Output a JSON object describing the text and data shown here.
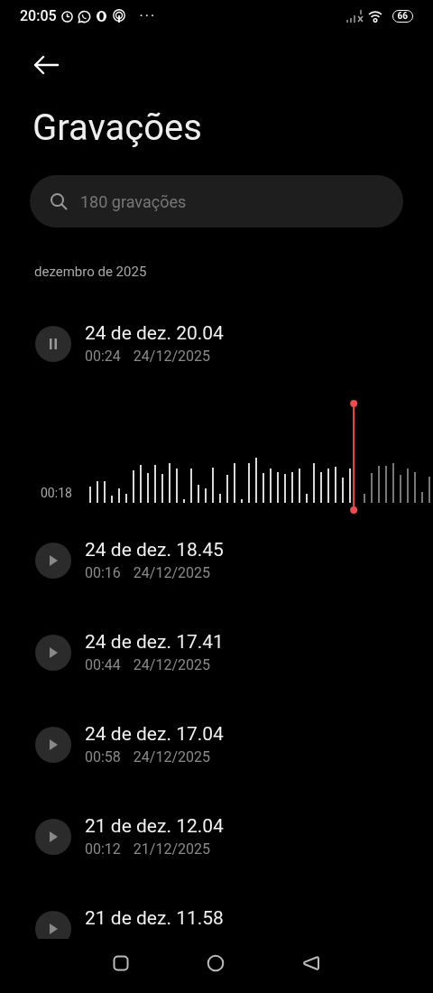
{
  "status_bar": {
    "time": "20:05",
    "more": "···",
    "battery": "66"
  },
  "title": "Gravações",
  "search": {
    "placeholder": "180 gravações"
  },
  "section": "dezembro de 2025",
  "recordings": [
    {
      "title": "24 de dez. 20.04",
      "duration": "00:24",
      "date": "24/12/2025",
      "playing": true,
      "position": "00:18",
      "level": 0.77
    },
    {
      "title": "24 de dez. 18.45",
      "duration": "00:16",
      "date": "24/12/2025",
      "playing": false
    },
    {
      "title": "24 de dez. 17.41",
      "duration": "00:44",
      "date": "24/12/2025",
      "playing": false
    },
    {
      "title": "24 de dez. 17.04",
      "duration": "00:58",
      "date": "24/12/2025",
      "playing": false
    },
    {
      "title": "21 de dez. 12.04",
      "duration": "00:12",
      "date": "21/12/2025",
      "playing": false
    },
    {
      "title": "21 de dez. 11.58",
      "playing": false
    }
  ]
}
